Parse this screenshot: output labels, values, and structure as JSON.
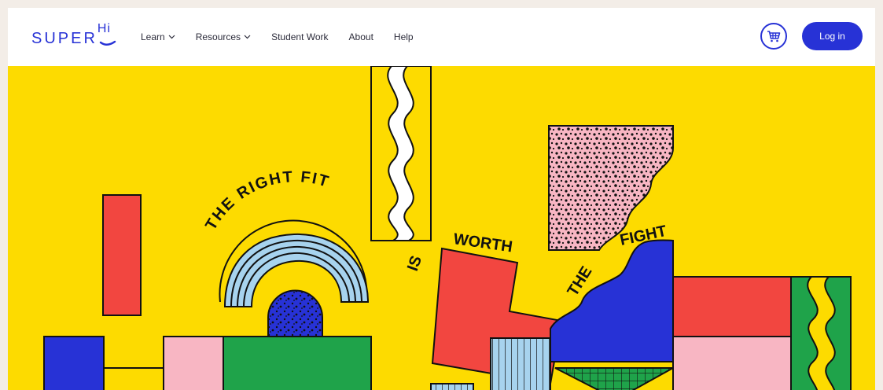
{
  "brand": {
    "logo_text": "SUPER",
    "logo_accent": "Hi",
    "color": "#2732d6"
  },
  "nav": {
    "items": [
      {
        "label": "Learn",
        "has_dropdown": true
      },
      {
        "label": "Resources",
        "has_dropdown": true
      },
      {
        "label": "Student Work",
        "has_dropdown": false
      },
      {
        "label": "About",
        "has_dropdown": false
      },
      {
        "label": "Help",
        "has_dropdown": false
      }
    ]
  },
  "actions": {
    "cart_icon": "shopping-cart-icon",
    "login_label": "Log in"
  },
  "hero": {
    "text_right_fit": "THE RIGHT FIT",
    "text_is": "IS",
    "text_worth": "WORTH",
    "text_the": "THE",
    "text_fight": "FIGHT",
    "colors": {
      "background": "#fddb00",
      "red": "#f24640",
      "blue": "#2732d6",
      "green": "#1fa34a",
      "pink": "#f8b6c3",
      "light_blue": "#a7d3ee",
      "black": "#111111"
    }
  }
}
